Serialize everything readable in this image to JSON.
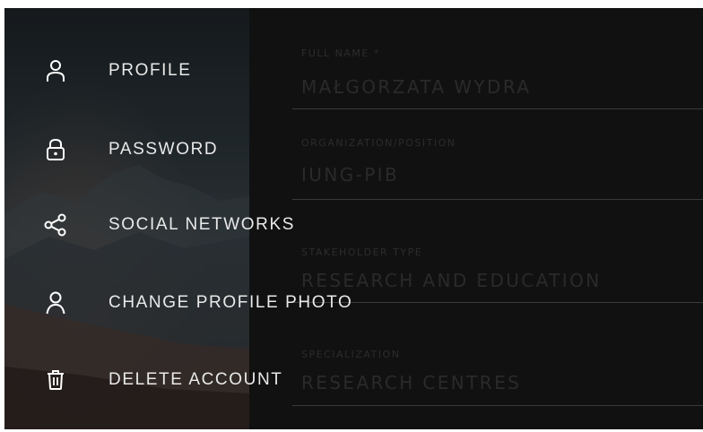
{
  "menu": {
    "items": [
      {
        "label": "PROFILE",
        "icon": "user-outline-icon"
      },
      {
        "label": "PASSWORD",
        "icon": "lock-icon"
      },
      {
        "label": "SOCIAL NETWORKS",
        "icon": "share-icon"
      },
      {
        "label": "CHANGE PROFILE PHOTO",
        "icon": "person-icon"
      },
      {
        "label": "DELETE ACCOUNT",
        "icon": "trash-icon"
      }
    ]
  },
  "form": {
    "fields": [
      {
        "label": "FULL NAME *",
        "value": "MAŁGORZATA WYDRA"
      },
      {
        "label": "ORGANIZATION/POSITION",
        "value": "IUNG-PIB"
      },
      {
        "label": "STAKEHOLDER TYPE",
        "value": "RESEARCH AND EDUCATION"
      },
      {
        "label": "SPECIALIZATION",
        "value": "RESEARCH CENTRES"
      }
    ]
  },
  "colors": {
    "background": "#111111",
    "menu_text": "#e9e9e9",
    "field_text_dim": "#2a2a2a",
    "divider": "#3a3a3a"
  }
}
